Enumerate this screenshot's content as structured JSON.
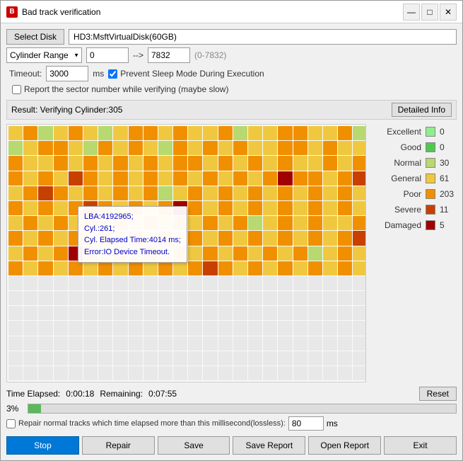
{
  "window": {
    "title": "Bad track verification",
    "icon": "B",
    "min_label": "—",
    "max_label": "□",
    "close_label": "✕"
  },
  "toolbar": {
    "select_disk_label": "Select Disk",
    "disk_value": "HD3:MsftVirtualDisk(60GB)",
    "cylinder_range_label": "Cylinder Range",
    "range_start": "0",
    "range_arrow": "-->",
    "range_end": "7832",
    "range_hint": "(0-7832)",
    "timeout_label": "Timeout:",
    "timeout_value": "3000",
    "ms_label": "ms",
    "prevent_sleep_checked": true,
    "prevent_sleep_label": "Prevent Sleep Mode During Execution",
    "report_sector_checked": false,
    "report_sector_label": "Report the sector number while verifying (maybe slow)"
  },
  "result": {
    "text": "Result:  Verifying Cylinder:305",
    "detailed_label": "Detailed Info"
  },
  "tooltip": {
    "line1": "LBA:4192965;",
    "line2": "Cyl.:261;",
    "line3": "Cyl. Elapsed Time:4014 ms;",
    "line4": "Error:IO Device Timeout."
  },
  "legend": {
    "items": [
      {
        "label": "Excellent",
        "color": "#90ee90",
        "count": "0"
      },
      {
        "label": "Good",
        "color": "#50c850",
        "count": "0"
      },
      {
        "label": "Normal",
        "color": "#b8d870",
        "count": "30"
      },
      {
        "label": "General",
        "color": "#f0c840",
        "count": "61"
      },
      {
        "label": "Poor",
        "color": "#f09000",
        "count": "203"
      },
      {
        "label": "Severe",
        "color": "#c84000",
        "count": "11"
      },
      {
        "label": "Damaged",
        "color": "#a00000",
        "count": "5"
      }
    ]
  },
  "status": {
    "time_elapsed_label": "Time Elapsed:",
    "time_elapsed_value": "0:00:18",
    "remaining_label": "Remaining:",
    "remaining_value": "0:07:55",
    "reset_label": "Reset",
    "progress_pct": "3%",
    "progress_value": 3
  },
  "repair": {
    "checkbox_label": "Repair normal tracks which time elapsed more than this millisecond(lossless):",
    "value": "80",
    "ms_label": "ms"
  },
  "footer": {
    "stop_label": "Stop",
    "repair_label": "Repair",
    "save_label": "Save",
    "save_report_label": "Save Report",
    "open_report_label": "Open Report",
    "exit_label": "Exit"
  },
  "colors": {
    "excellent": "#90ee90",
    "good": "#50c850",
    "normal": "#b8d870",
    "general": "#f0c840",
    "poor": "#f09000",
    "severe": "#c84000",
    "damaged": "#a00000"
  }
}
